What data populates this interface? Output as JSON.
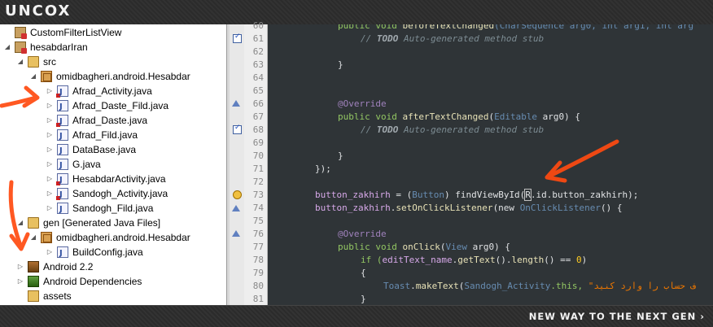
{
  "banner": {
    "logo": "UNCOX",
    "slogan": "NEW WAY TO THE NEXT GEN ›"
  },
  "explorer": {
    "items": [
      {
        "label": "CustomFilterListView",
        "icon": "project-icon"
      },
      {
        "label": "hesabdarIran",
        "icon": "project-icon"
      },
      {
        "label": "src",
        "icon": "source-folder-icon"
      },
      {
        "label": "omidbagheri.android.Hesabdar",
        "icon": "package-icon"
      },
      {
        "label": "Afrad_Activity.java",
        "icon": "java-file-icon"
      },
      {
        "label": "Afrad_Daste_Fild.java",
        "icon": "java-file-icon"
      },
      {
        "label": "Afrad_Daste.java",
        "icon": "java-file-icon"
      },
      {
        "label": "Afrad_Fild.java",
        "icon": "java-file-icon"
      },
      {
        "label": "DataBase.java",
        "icon": "java-file-icon"
      },
      {
        "label": "G.java",
        "icon": "java-file-icon"
      },
      {
        "label": "HesabdarActivity.java",
        "icon": "java-file-icon"
      },
      {
        "label": "Sandogh_Activity.java",
        "icon": "java-file-icon"
      },
      {
        "label": "Sandogh_Fild.java",
        "icon": "java-file-icon"
      },
      {
        "label": "gen [Generated Java Files]",
        "icon": "source-folder-icon"
      },
      {
        "label": "omidbagheri.android.Hesabdar",
        "icon": "package-icon"
      },
      {
        "label": "BuildConfig.java",
        "icon": "java-file-icon"
      },
      {
        "label": "Android 2.2",
        "icon": "library-icon"
      },
      {
        "label": "Android Dependencies",
        "icon": "library-icon"
      },
      {
        "label": "assets",
        "icon": "folder-icon"
      }
    ]
  },
  "editor": {
    "line_numbers": [
      "60",
      "61",
      "62",
      "63",
      "64",
      "65",
      "66",
      "67",
      "68",
      "69",
      "70",
      "71",
      "72",
      "73",
      "74",
      "75",
      "76",
      "77",
      "78",
      "79",
      "80",
      "81"
    ],
    "code": {
      "l60": {
        "a": "public void ",
        "b": "beforeTextChanged",
        "c": "(CharSequence arg0, int arg1, int arg"
      },
      "l61_todo": "TODO",
      "l61_rest": " Auto-generated method stub",
      "l61_prefix": "// ",
      "l63": "}",
      "l66": "@Override",
      "l67": {
        "a": "public void ",
        "b": "afterTextChanged",
        "c": "(",
        "d": "Editable",
        "e": " arg0) {"
      },
      "l68_prefix": "// ",
      "l68_todo": "TODO",
      "l68_rest": " Auto-generated method stub",
      "l70": "}",
      "l71": "});",
      "l73": {
        "a": "button_zakhirh",
        "b": " = (",
        "c": "Button",
        "d": ") findViewById(",
        "e": "R",
        "f": ".id.button_zakhirh);"
      },
      "l74": {
        "a": "button_zakhirh",
        "b": ".",
        "c": "setOnClickListener",
        "d": "(new ",
        "e": "OnClickListener",
        "f": "() {"
      },
      "l76": "@Override",
      "l77": {
        "a": "public void ",
        "b": "onClick",
        "c": "(",
        "d": "View",
        "e": " arg0) {"
      },
      "l78": {
        "a": "if (",
        "b": "editText_name",
        "c": ".",
        "d": "getText",
        "e": "().",
        "f": "length",
        "g": "() == ",
        "h": "0",
        "i": ")"
      },
      "l79": "{",
      "l80": {
        "a": "Toast",
        "b": ".",
        "c": "makeText",
        "d": "(",
        "e": "Sandogh_Activity",
        "f": ".this, ",
        "g": "\"ف حساب را وارد کنید"
      },
      "l81": "}"
    }
  },
  "colors": {
    "editor_bg": "#2f3437",
    "keyword": "#93c763",
    "annotation": "#a082bd",
    "comment": "#7d8c93",
    "annotation_arrow": "#ff4a10"
  }
}
